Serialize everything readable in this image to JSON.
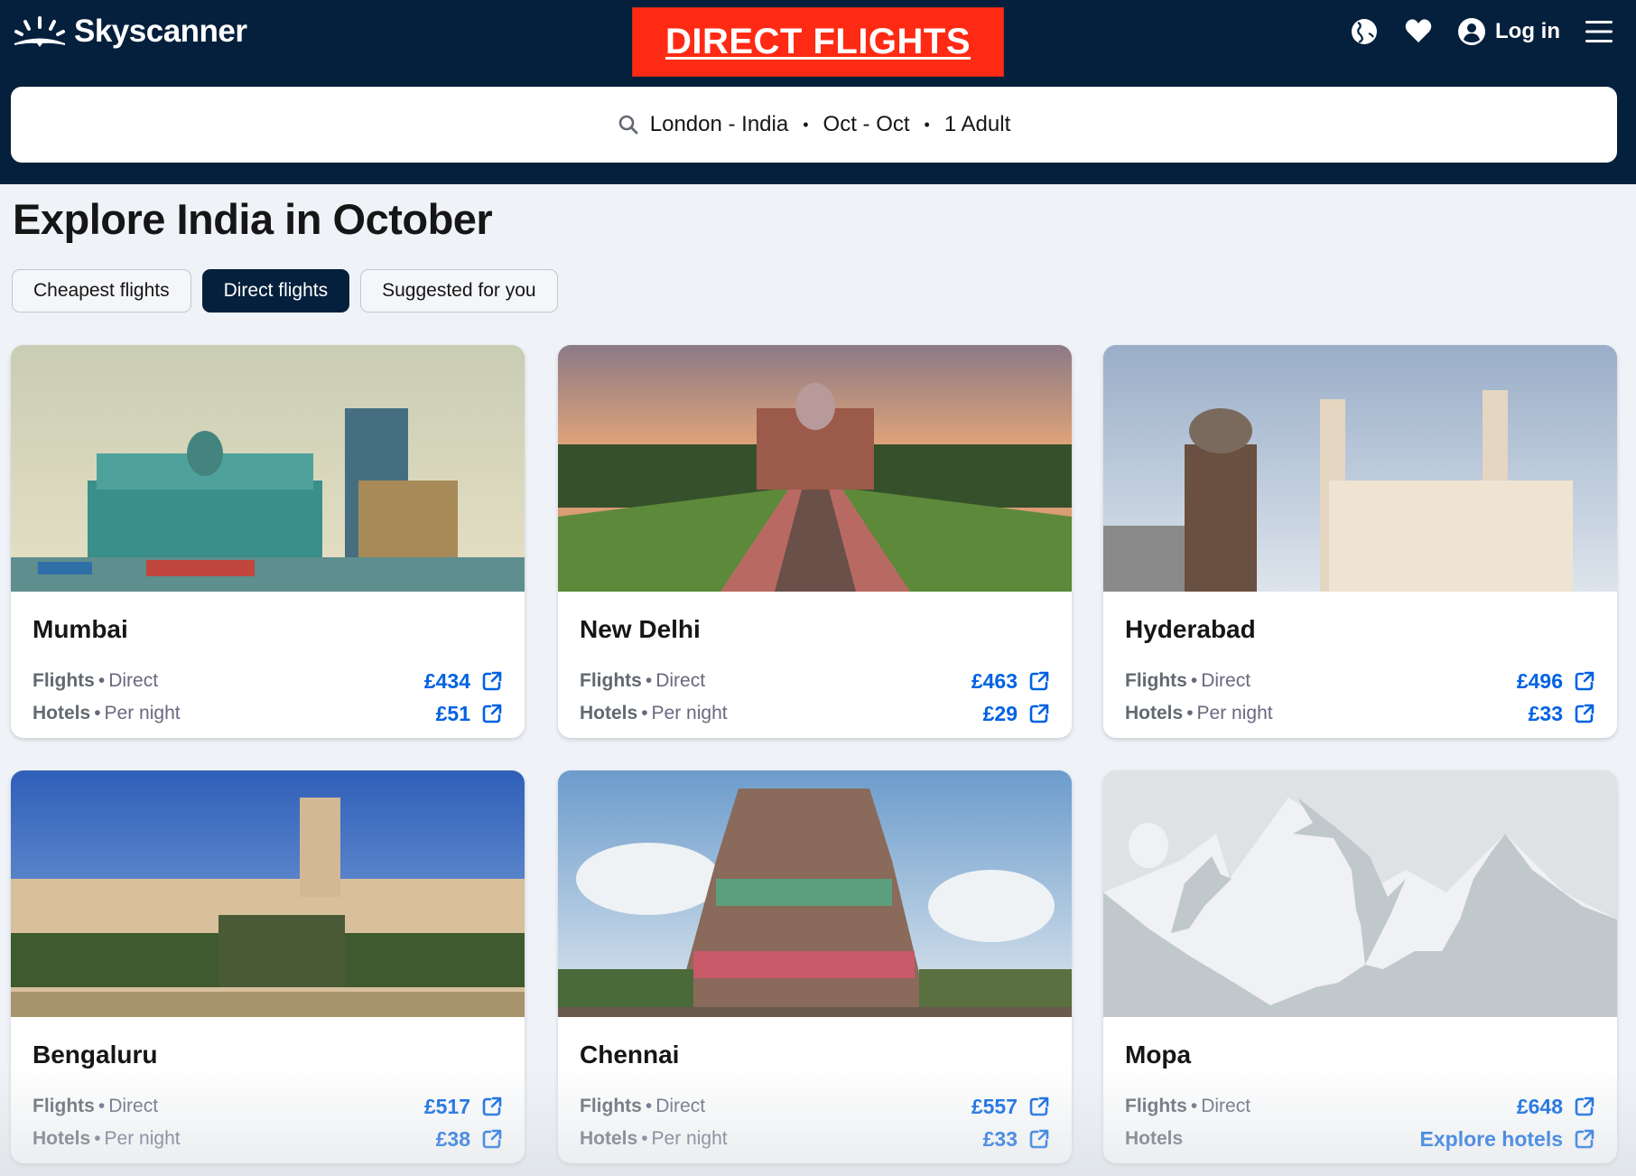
{
  "header": {
    "logo_text": "Skyscanner",
    "promo_banner": "DIRECT FLIGHTS",
    "login_label": "Log in",
    "icons": [
      "globe-icon",
      "heart-icon",
      "user-icon",
      "menu-icon"
    ]
  },
  "search": {
    "route": "London - India",
    "dates": "Oct - Oct",
    "travellers": "1 Adult",
    "separator": "•"
  },
  "page": {
    "title": "Explore India in October"
  },
  "tabs": [
    {
      "label": "Cheapest flights",
      "active": false
    },
    {
      "label": "Direct flights",
      "active": true
    },
    {
      "label": "Suggested for you",
      "active": false
    }
  ],
  "cards": [
    {
      "city": "Mumbai",
      "flights_label": "Flights",
      "flights_type": "Direct",
      "flights_price": "£434",
      "hotels_label": "Hotels",
      "hotels_type": "Per night",
      "hotels_price": "£51"
    },
    {
      "city": "New Delhi",
      "flights_label": "Flights",
      "flights_type": "Direct",
      "flights_price": "£463",
      "hotels_label": "Hotels",
      "hotels_type": "Per night",
      "hotels_price": "£29"
    },
    {
      "city": "Hyderabad",
      "flights_label": "Flights",
      "flights_type": "Direct",
      "flights_price": "£496",
      "hotels_label": "Hotels",
      "hotels_type": "Per night",
      "hotels_price": "£33"
    },
    {
      "city": "Bengaluru",
      "flights_label": "Flights",
      "flights_type": "Direct",
      "flights_price": "£517",
      "hotels_label": "Hotels",
      "hotels_type": "Per night",
      "hotels_price": "£38"
    },
    {
      "city": "Chennai",
      "flights_label": "Flights",
      "flights_type": "Direct",
      "flights_price": "£557",
      "hotels_label": "Hotels",
      "hotels_type": "Per night",
      "hotels_price": "£33"
    },
    {
      "city": "Mopa",
      "flights_label": "Flights",
      "flights_type": "Direct",
      "flights_price": "£648",
      "hotels_label": "Hotels",
      "hotels_type": "",
      "hotels_price": "Explore hotels"
    }
  ],
  "colors": {
    "header_bg": "#05203c",
    "promo_red": "#ff2a14",
    "link_blue": "#0062e3",
    "page_bg": "#eff3f8"
  }
}
